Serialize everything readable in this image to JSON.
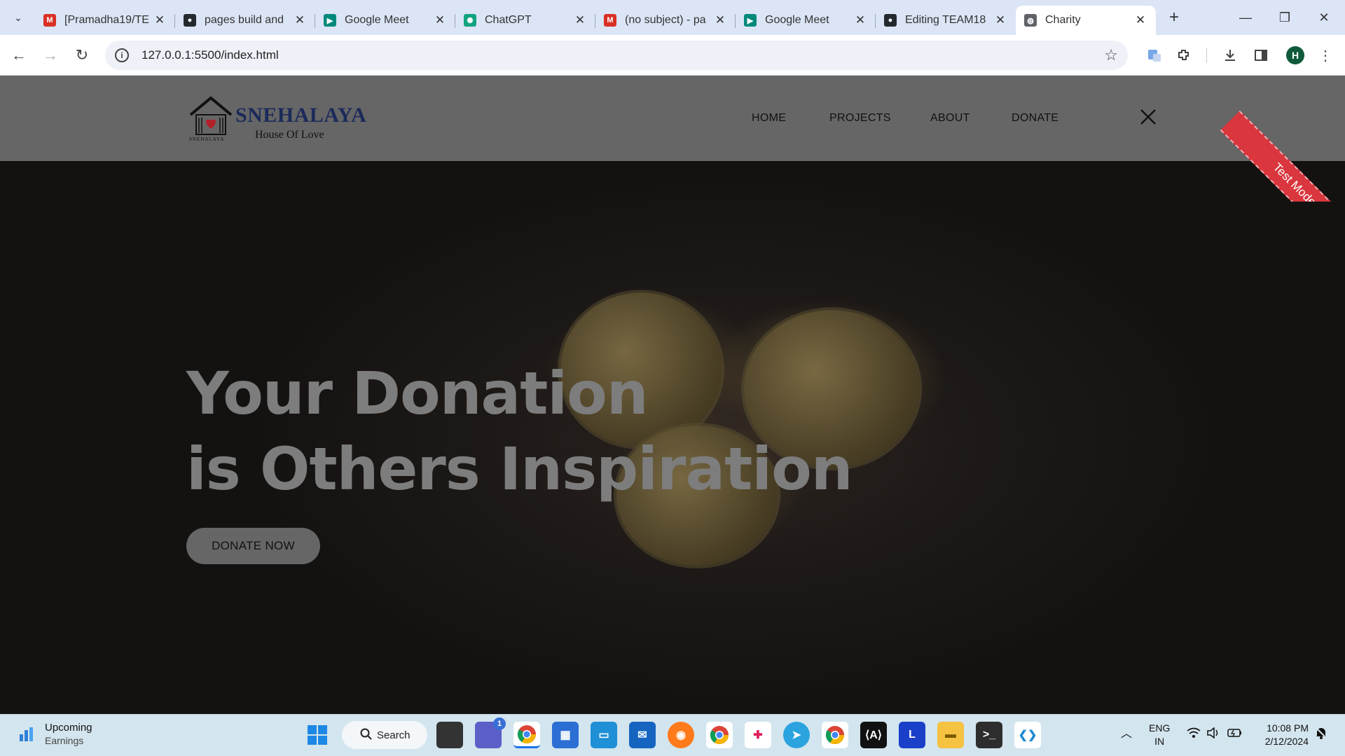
{
  "browser": {
    "tabs": [
      {
        "title": "[Pramadha19/TE",
        "icon": "gmail-icon",
        "color": "#d93025",
        "glyph": "M"
      },
      {
        "title": "pages build and",
        "icon": "github-build-icon",
        "color": "#24292f",
        "glyph": "●"
      },
      {
        "title": "Google Meet",
        "icon": "google-meet-icon",
        "color": "#00897b",
        "glyph": "▶"
      },
      {
        "title": "ChatGPT",
        "icon": "chatgpt-icon",
        "color": "#10a37f",
        "glyph": "✺"
      },
      {
        "title": "(no subject) - pa",
        "icon": "gmail-icon",
        "color": "#d93025",
        "glyph": "M"
      },
      {
        "title": "Google Meet",
        "icon": "google-meet-icon",
        "color": "#00897b",
        "glyph": "▶"
      },
      {
        "title": "Editing TEAM18",
        "icon": "github-icon",
        "color": "#24292f",
        "glyph": "●"
      },
      {
        "title": "Charity",
        "icon": "globe-icon",
        "color": "#5f6368",
        "glyph": "◍"
      }
    ],
    "url": "127.0.0.1:5500/index.html",
    "profile_initial": "H"
  },
  "site": {
    "logo_name": "SNEHALAYA",
    "logo_tagline": "House Of Love",
    "logo_small": "SNEHALAYA",
    "nav": [
      "HOME",
      "PROJECTS",
      "ABOUT",
      "DONATE"
    ],
    "ribbon": "Test Mode",
    "headline_line1": "Your Donation",
    "headline_line2": "is Others Inspiration",
    "cta": "DONATE NOW"
  },
  "taskbar": {
    "weather_title": "Upcoming",
    "weather_sub": "Earnings",
    "search": "Search",
    "lang1": "ENG",
    "lang2": "IN",
    "time": "10:08 PM",
    "date": "2/12/2024",
    "chat_badge": "1"
  }
}
